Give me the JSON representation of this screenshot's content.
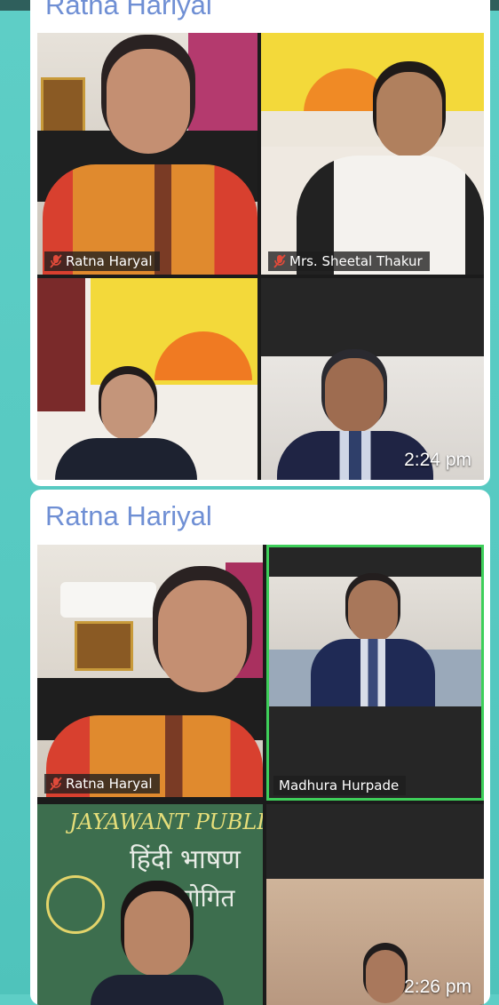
{
  "colors": {
    "background": "#5ecec6",
    "sender_name": "#6f8fd4",
    "bubble": "#ffffff",
    "active_speaker_border": "#3ecf5a",
    "muted_icon": "#e04a3a"
  },
  "messages": [
    {
      "sender": "Ratna Hariyal",
      "time": "2:24 pm",
      "tiles": [
        {
          "name": "Ratna Haryal",
          "muted": true
        },
        {
          "name": "Mrs. Sheetal Thakur",
          "muted": true
        },
        {
          "name": "",
          "muted": false
        },
        {
          "name": "",
          "muted": false
        }
      ]
    },
    {
      "sender": "Ratna Hariyal",
      "time": "2:26 pm",
      "tiles": [
        {
          "name": "Ratna Haryal",
          "muted": true
        },
        {
          "name": "Madhura Hurpade",
          "muted": false,
          "active_speaker": true
        },
        {
          "name": "",
          "muted": false,
          "board_text_1": "JAYAWANT PUBLIC",
          "board_text_2": "हिंदी भाषण",
          "board_text_3": "योगित"
        },
        {
          "name": "",
          "muted": false
        }
      ]
    }
  ]
}
